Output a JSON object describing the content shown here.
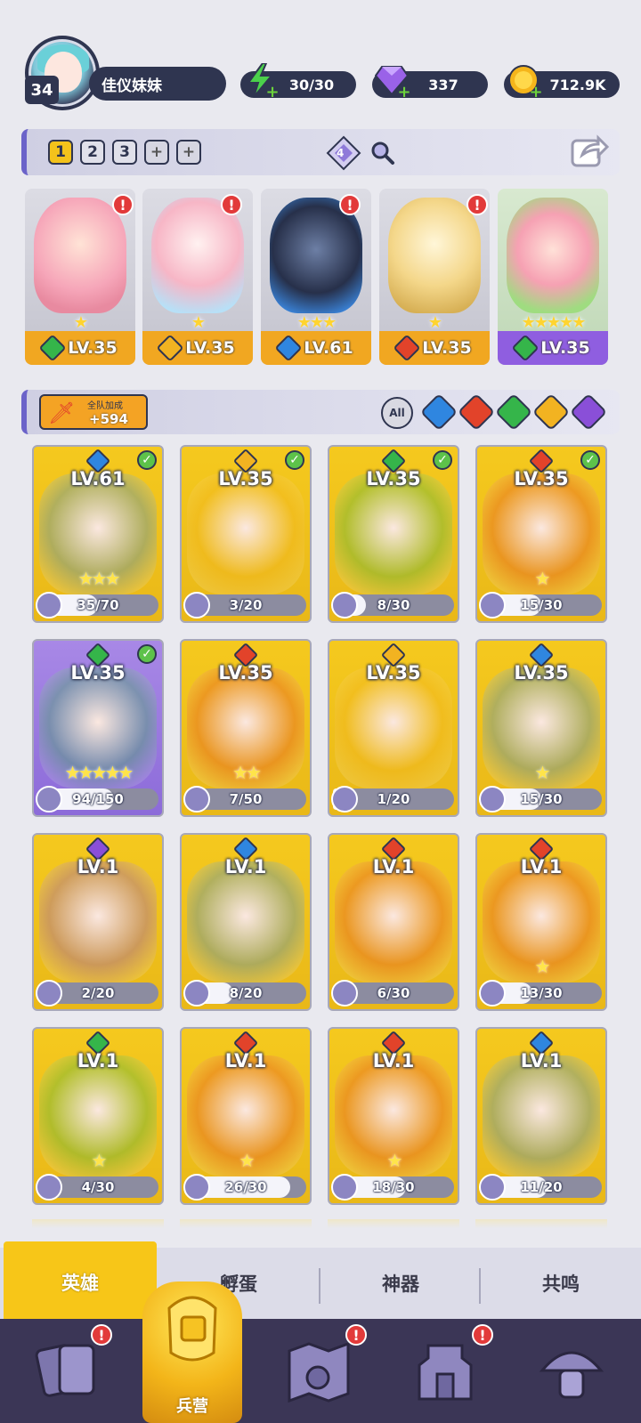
{
  "profile": {
    "level": "34",
    "name": "佳仪妹妹"
  },
  "resources": [
    {
      "name": "energy",
      "icon": "lightning-icon",
      "value": "30/30",
      "color": "#4bd04b"
    },
    {
      "name": "gems",
      "icon": "gem-icon",
      "value": "337",
      "color": "#9a62e8"
    },
    {
      "name": "gold",
      "icon": "coin-icon",
      "value": "712.9K",
      "color": "#f5b51b"
    }
  ],
  "team_bar": {
    "slots": [
      "1",
      "2",
      "3",
      "+",
      "+"
    ],
    "active_slot": "1",
    "crystal_count": "4"
  },
  "team": [
    {
      "level": "LV.35",
      "element": "wind",
      "stars": "★",
      "alert": "!"
    },
    {
      "level": "LV.35",
      "element": "light",
      "stars": "★",
      "alert": "!"
    },
    {
      "level": "LV.61",
      "element": "water",
      "stars": "★★★",
      "alert": "!"
    },
    {
      "level": "LV.35",
      "element": "fire",
      "stars": "★",
      "alert": "!"
    },
    {
      "level": "LV.35",
      "element": "wind",
      "stars": "★★★★★",
      "alert": ""
    }
  ],
  "bonus": {
    "label": "全队加成",
    "value": "+594"
  },
  "filters": [
    "All",
    "water",
    "fire",
    "wind",
    "light",
    "dark"
  ],
  "element_colors": {
    "water": "#2f86e0",
    "fire": "#e2432a",
    "wind": "#35b54a",
    "light": "#f2b321",
    "dark": "#8a4fd8"
  },
  "heroes": [
    {
      "level": "LV.61",
      "element": "water",
      "stars": "★★★",
      "shards": "35/70",
      "progress": 0.5,
      "owned": true,
      "frame": "gold"
    },
    {
      "level": "LV.35",
      "element": "light",
      "stars": "",
      "shards": "3/20",
      "progress": 0.15,
      "owned": true,
      "frame": "gold"
    },
    {
      "level": "LV.35",
      "element": "wind",
      "stars": "",
      "shards": "8/30",
      "progress": 0.27,
      "owned": true,
      "frame": "gold"
    },
    {
      "level": "LV.35",
      "element": "fire",
      "stars": "★",
      "shards": "15/30",
      "progress": 0.5,
      "owned": true,
      "frame": "gold"
    },
    {
      "level": "LV.35",
      "element": "wind",
      "stars": "★★★★★",
      "shards": "94/150",
      "progress": 0.63,
      "owned": true,
      "frame": "purple"
    },
    {
      "level": "LV.35",
      "element": "fire",
      "stars": "★★",
      "shards": "7/50",
      "progress": 0.14,
      "owned": false,
      "frame": "gold"
    },
    {
      "level": "LV.35",
      "element": "light",
      "stars": "",
      "shards": "1/20",
      "progress": 0.05,
      "owned": false,
      "frame": "gold"
    },
    {
      "level": "LV.35",
      "element": "water",
      "stars": "★",
      "shards": "15/30",
      "progress": 0.5,
      "owned": false,
      "frame": "gold"
    },
    {
      "level": "LV.1",
      "element": "dark",
      "stars": "",
      "shards": "2/20",
      "progress": 0.1,
      "owned": false,
      "frame": "gold"
    },
    {
      "level": "LV.1",
      "element": "water",
      "stars": "",
      "shards": "8/20",
      "progress": 0.4,
      "owned": false,
      "frame": "gold"
    },
    {
      "level": "LV.1",
      "element": "fire",
      "stars": "",
      "shards": "6/30",
      "progress": 0.2,
      "owned": false,
      "frame": "gold"
    },
    {
      "level": "LV.1",
      "element": "fire",
      "stars": "★",
      "shards": "13/30",
      "progress": 0.43,
      "owned": false,
      "frame": "gold"
    },
    {
      "level": "LV.1",
      "element": "wind",
      "stars": "★",
      "shards": "4/30",
      "progress": 0.13,
      "owned": false,
      "frame": "gold"
    },
    {
      "level": "LV.1",
      "element": "fire",
      "stars": "★",
      "shards": "26/30",
      "progress": 0.87,
      "owned": false,
      "frame": "gold"
    },
    {
      "level": "LV.1",
      "element": "fire",
      "stars": "★",
      "shards": "18/30",
      "progress": 0.6,
      "owned": false,
      "frame": "gold"
    },
    {
      "level": "LV.1",
      "element": "water",
      "stars": "",
      "shards": "11/20",
      "progress": 0.55,
      "owned": false,
      "frame": "gold"
    }
  ],
  "subtabs": [
    "英雄",
    "孵蛋",
    "神器",
    "共鸣"
  ],
  "active_subtab": "英雄",
  "bottom_nav": {
    "items": [
      {
        "icon": "cards-icon",
        "alert": "!"
      },
      {
        "icon": "barracks-icon",
        "label": "兵营",
        "alert": ""
      },
      {
        "icon": "map-icon",
        "alert": "!"
      },
      {
        "icon": "castle-icon",
        "alert": "!"
      },
      {
        "icon": "mushroom-icon",
        "alert": ""
      }
    ]
  }
}
